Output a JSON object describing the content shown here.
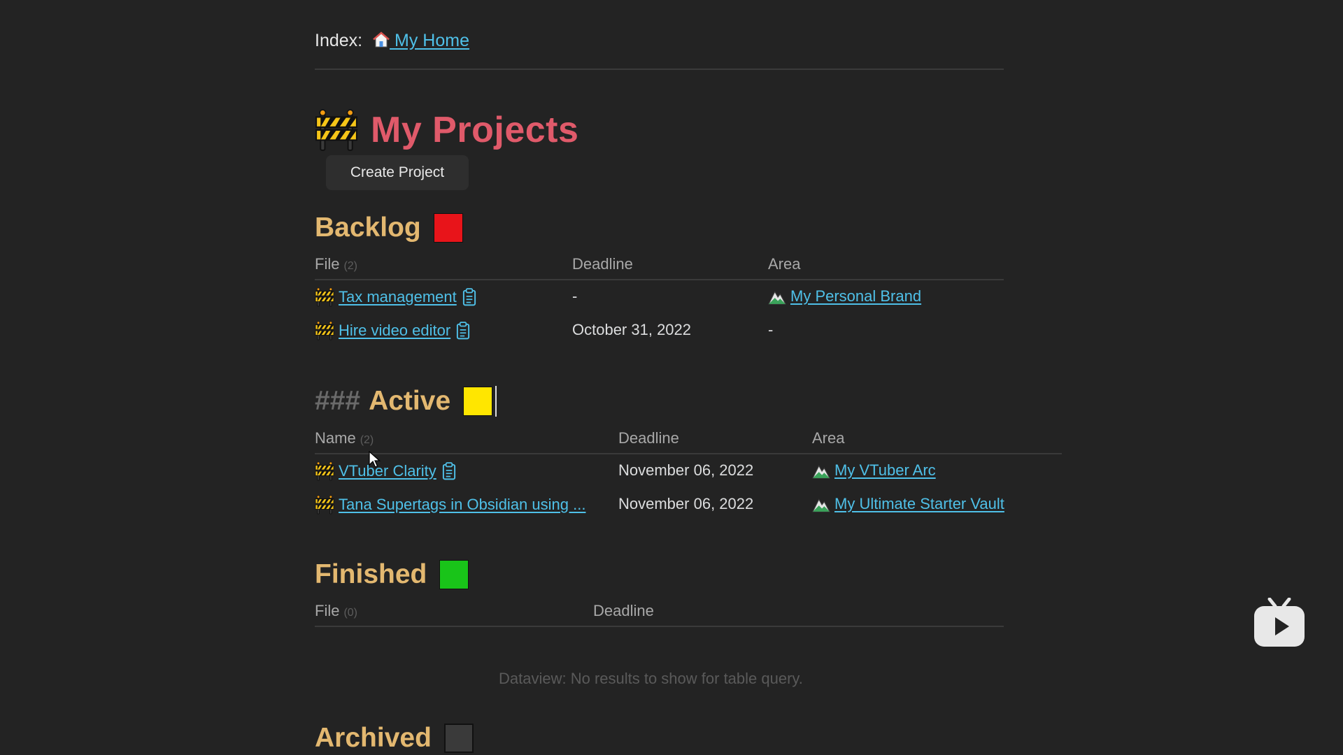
{
  "index": {
    "label": "Index:",
    "link": "My Home"
  },
  "page": {
    "title": "My Projects",
    "create_button": "Create Project"
  },
  "backlog": {
    "heading": "Backlog",
    "color": "#e8141a",
    "columns": {
      "file": "File",
      "count": "(2)",
      "deadline": "Deadline",
      "area": "Area"
    },
    "rows": [
      {
        "file": "Tax management",
        "deadline": "-",
        "area": "My Personal Brand"
      },
      {
        "file": "Hire video editor",
        "deadline": "October 31, 2022",
        "area": "-"
      }
    ]
  },
  "active": {
    "hash": "###",
    "heading": "Active",
    "color": "#ffe600",
    "columns": {
      "name": "Name",
      "count": "(2)",
      "deadline": "Deadline",
      "area": "Area"
    },
    "rows": [
      {
        "name": "VTuber Clarity",
        "deadline": "November 06, 2022",
        "area": "My VTuber Arc"
      },
      {
        "name": "Tana Supertags in Obsidian using ...",
        "deadline": "November 06, 2022",
        "area": "My Ultimate Starter Vault"
      }
    ]
  },
  "finished": {
    "heading": "Finished",
    "color": "#19c419",
    "columns": {
      "file": "File",
      "count": "(0)",
      "deadline": "Deadline"
    },
    "empty_message": "Dataview: No results to show for table query."
  },
  "archived": {
    "heading": "Archived",
    "color": "#3a3a3a"
  },
  "icons": {
    "home": "house-icon",
    "project": "construction-barrier-icon",
    "area": "mountain-icon",
    "note": "clipboard-icon",
    "watermark": "tv-play-icon"
  }
}
